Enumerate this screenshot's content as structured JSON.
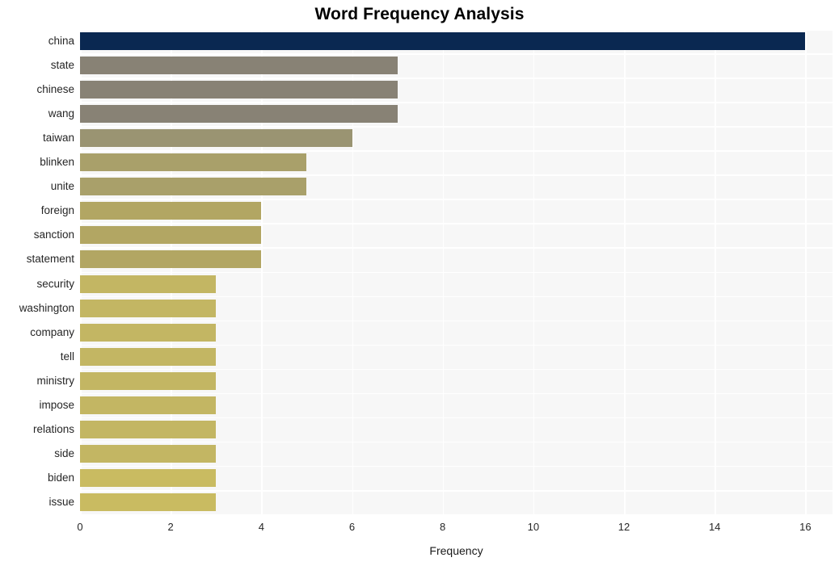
{
  "chart_data": {
    "type": "bar",
    "orientation": "horizontal",
    "title": "Word Frequency Analysis",
    "xlabel": "Frequency",
    "ylabel": "",
    "categories": [
      "china",
      "state",
      "chinese",
      "wang",
      "taiwan",
      "blinken",
      "unite",
      "foreign",
      "sanction",
      "statement",
      "security",
      "washington",
      "company",
      "tell",
      "ministry",
      "impose",
      "relations",
      "side",
      "biden",
      "issue"
    ],
    "values": [
      16,
      7,
      7,
      7,
      6,
      5,
      5,
      4,
      4,
      4,
      3,
      3,
      3,
      3,
      3,
      3,
      3,
      3,
      3,
      3
    ],
    "bar_colors": [
      "#0a2851",
      "#888275",
      "#888275",
      "#888275",
      "#9a9472",
      "#a9a06a",
      "#a9a06a",
      "#b2a663",
      "#b2a663",
      "#b2a663",
      "#c3b663",
      "#c3b663",
      "#c3b663",
      "#c3b663",
      "#c3b663",
      "#c3b663",
      "#c3b663",
      "#c3b663",
      "#c9bb61",
      "#c9bb61"
    ],
    "xlim": [
      0,
      16.6
    ],
    "xticks": [
      0,
      2,
      4,
      6,
      8,
      10,
      12,
      14,
      16
    ],
    "xtick_labels": [
      "0",
      "2",
      "4",
      "6",
      "8",
      "10",
      "12",
      "14",
      "16"
    ],
    "grid": true,
    "grid_color": "#ffffff",
    "plot_background": "#f7f7f7",
    "figure_background": "#ffffff",
    "legend": null
  }
}
